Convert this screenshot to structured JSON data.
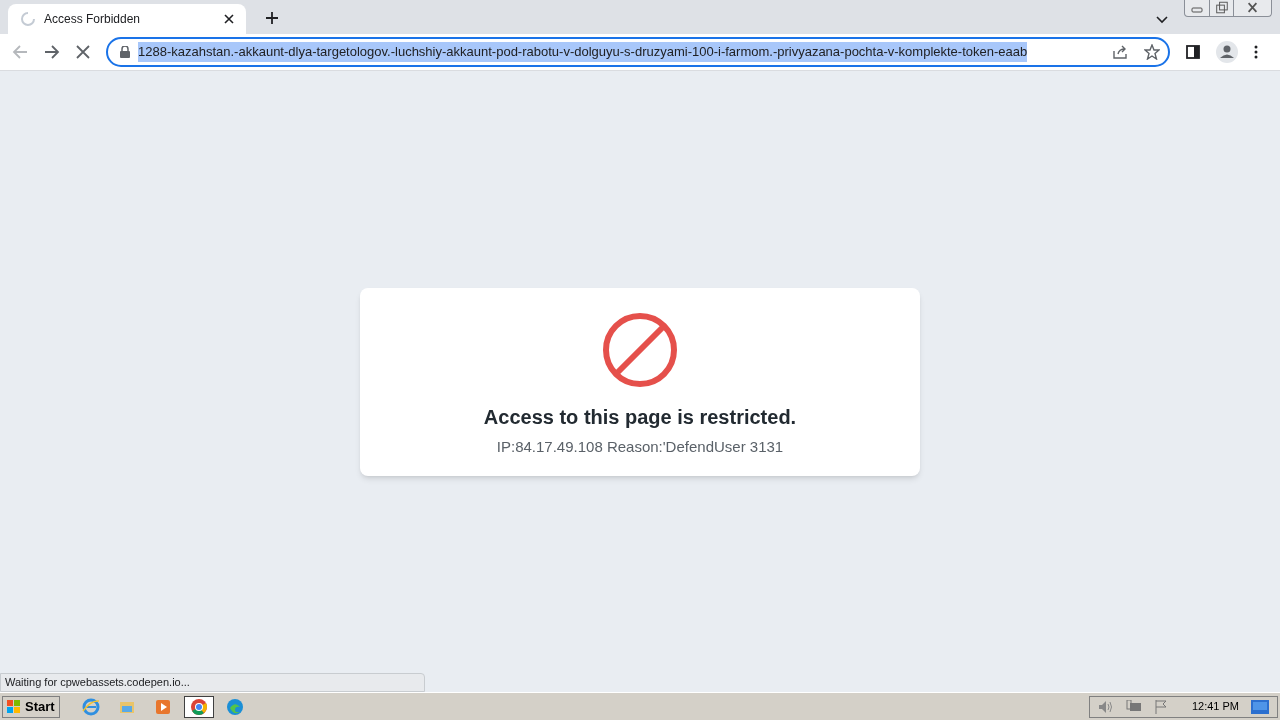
{
  "tabs": [
    {
      "title": "Access Forbidden",
      "loading": true,
      "selected": true
    }
  ],
  "address_bar": {
    "url": "1288-kazahstan.-akkaunt-dlya-targetologov.-luchshiy-akkaunt-pod-rabotu-v-dolguyu-s-druzyami-100-i-farmom.-privyazana-pochta-v-komplekte-token-eaab",
    "highlighted": true
  },
  "page": {
    "heading": "Access to this page is restricted.",
    "detail": "IP:84.17.49.108 Reason:'DefendUser 3131"
  },
  "status_bubble": "Waiting for cpwebassets.codepen.io...",
  "taskbar": {
    "start": "Start",
    "apps": [
      {
        "kind": "ie",
        "active": false
      },
      {
        "kind": "explorer",
        "active": false
      },
      {
        "kind": "media",
        "active": false
      },
      {
        "kind": "chrome",
        "active": true
      },
      {
        "kind": "edge",
        "active": false
      }
    ],
    "clock": "12:41 PM"
  }
}
